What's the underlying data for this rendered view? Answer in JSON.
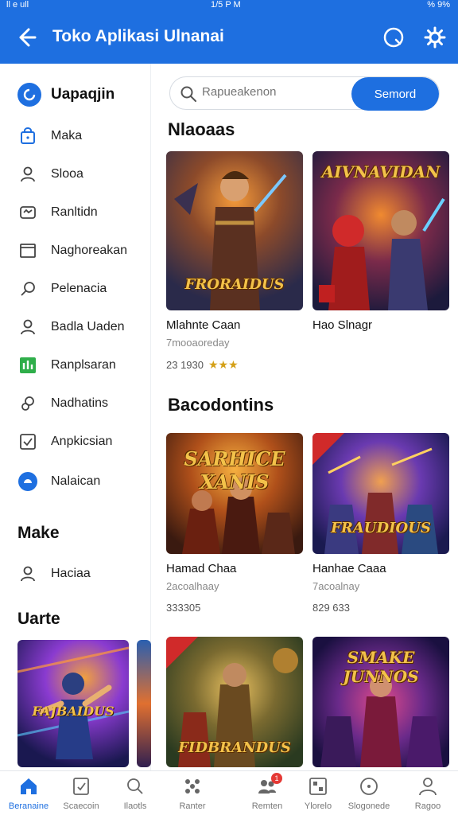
{
  "status": {
    "left": "ll e ull",
    "time": "1/5 P M",
    "right": "% 9%"
  },
  "appbar": {
    "title": "Toko Aplikasi Ulnanai",
    "back_icon": "back-arrow-icon",
    "search_icon": "search-icon",
    "settings_icon": "gear-icon"
  },
  "sidebar": {
    "header": "Uapaqjin",
    "items": [
      {
        "label": "Maka",
        "icon": "bag-icon"
      },
      {
        "label": "Slooa",
        "icon": "user-icon"
      },
      {
        "label": "Ranltidn",
        "icon": "inbox-icon"
      },
      {
        "label": "Naghoreakan",
        "icon": "window-icon"
      },
      {
        "label": "Pelenacia",
        "icon": "leaf-icon"
      },
      {
        "label": "Badla Uaden",
        "icon": "user-icon"
      },
      {
        "label": "Ranplsaran",
        "icon": "chart-icon"
      },
      {
        "label": "Nadhatins",
        "icon": "link-icon"
      },
      {
        "label": "Anpkicsian",
        "icon": "checkbox-icon"
      },
      {
        "label": "Nalaican",
        "icon": "circle-icon"
      }
    ],
    "section2_title": "Make",
    "section2_items": [
      {
        "label": "Haciaa",
        "icon": "user-icon"
      }
    ],
    "section3_title": "Uarte"
  },
  "search": {
    "placeholder": "Rapueakenon",
    "button": "Semord"
  },
  "sections": [
    {
      "title": "Nlaoaas",
      "cards": [
        {
          "name": "Mlahnte Caan",
          "sub": "7mooaoreday",
          "rating": "23 1930",
          "art": "FRORAIDUS",
          "stars": 3
        },
        {
          "name": "Hao Slnagr",
          "sub": "",
          "rating": "",
          "art": "AIVNAVIDAN",
          "stars": 0
        }
      ]
    },
    {
      "title": "Bacodontins",
      "cards": [
        {
          "name": "Hamad Chaa",
          "sub": "2acoalhaay",
          "rating": "333305",
          "art": "SARHICE XANIS"
        },
        {
          "name": "Hanhae Caaa",
          "sub": "7acoalnay",
          "rating": "829 633",
          "art": "FRAUDIOUS"
        }
      ]
    },
    {
      "title": "",
      "cards": [
        {
          "name": "",
          "sub": "",
          "rating": "",
          "art": "FIDBRANDUS"
        },
        {
          "name": "",
          "sub": "",
          "rating": "",
          "art": "SMAKE JUNNOS"
        }
      ]
    }
  ],
  "sidebar_thumb_art": "FAJBAIDUS",
  "bottomnav": [
    {
      "label": "Beranaine",
      "icon": "home-icon",
      "active": true
    },
    {
      "label": "Scaecoin",
      "icon": "document-icon"
    },
    {
      "label": "Ilaotls",
      "icon": "search-icon"
    },
    {
      "label": "Ranter",
      "icon": "grid-icon"
    },
    {
      "label": "Remten",
      "icon": "users-icon",
      "badge": "1"
    },
    {
      "label": "Ylorelo",
      "icon": "board-icon"
    },
    {
      "label": "Slogonede",
      "icon": "compass-icon"
    },
    {
      "label": "Ragoo",
      "icon": "profile-icon"
    }
  ],
  "colors": {
    "brand": "#1e6fe0"
  }
}
